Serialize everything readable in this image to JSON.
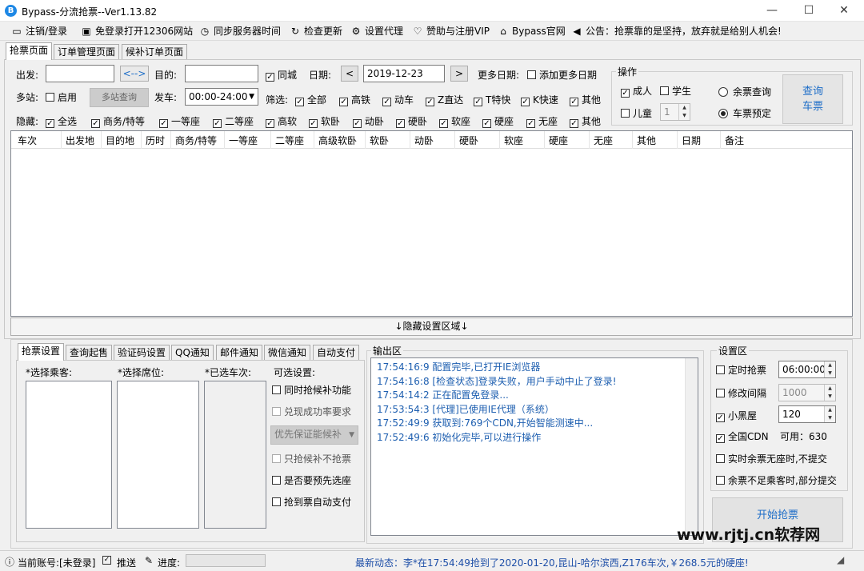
{
  "window": {
    "title": "Bypass-分流抢票--Ver1.13.82",
    "app_icon": "bypass-logo",
    "minimize": "—",
    "maximize": "☐",
    "close": "✕"
  },
  "menu": [
    {
      "label": "注销/登录",
      "icon": "monitor-icon"
    },
    {
      "label": "免登录打开12306网站",
      "icon": "window-icon"
    },
    {
      "label": "同步服务器时间",
      "icon": "clock-icon"
    },
    {
      "label": "检查更新",
      "icon": "refresh-icon"
    },
    {
      "label": "设置代理",
      "icon": "gear-icon"
    },
    {
      "label": "赞助与注册VIP",
      "icon": "heart-icon"
    },
    {
      "label": "Bypass官网",
      "icon": "home-icon"
    },
    {
      "label": "公告：抢票靠的是坚持，放弃就是给别人机会!",
      "icon": "speaker-icon"
    }
  ],
  "main_tabs": [
    "抢票页面",
    "订单管理页面",
    "候补订单页面"
  ],
  "query": {
    "from_label": "出发:",
    "from_value": "",
    "swap_label": "<-->",
    "to_label": "目的:",
    "to_value": "",
    "same_city_label": "同城",
    "same_city_checked": true,
    "date_label": "日期:",
    "date_prev": "<",
    "date_value": "2019-12-23",
    "date_next": ">",
    "more_dates_label": "更多日期:",
    "add_more_dates_label": "添加更多日期",
    "multi_station_label": "多站:",
    "enable_label": "启用",
    "multi_query_button": "多站查询",
    "depart_label": "发车:",
    "depart_value": "00:00-24:00",
    "filter_label": "筛选:",
    "filters": [
      "全部",
      "高铁",
      "动车",
      "Z直达",
      "T特快",
      "K快速",
      "其他"
    ],
    "hide_label": "隐藏:",
    "hide_options": [
      "全选",
      "商务/特等",
      "一等座",
      "二等座",
      "高软",
      "软卧",
      "动卧",
      "硬卧",
      "软座",
      "硬座",
      "无座",
      "其他"
    ]
  },
  "operation": {
    "title": "操作",
    "adult_label": "成人",
    "student_label": "学生",
    "child_label": "儿童",
    "child_count": "1",
    "remaining_query_label": "余票查询",
    "reserve_label": "车票预定",
    "query_button": "查询\n车票"
  },
  "table": {
    "columns": [
      "车次",
      "出发地",
      "目的地",
      "历时",
      "商务/特等",
      "一等座",
      "二等座",
      "高级软卧",
      "软卧",
      "动卧",
      "硬卧",
      "软座",
      "硬座",
      "无座",
      "其他",
      "日期",
      "备注"
    ]
  },
  "hide_settings_bar": "↓隐藏设置区域↓",
  "settings_tabs": [
    "抢票设置",
    "查询起售",
    "验证码设置",
    "QQ通知",
    "邮件通知",
    "微信通知",
    "自动支付"
  ],
  "ticket_settings": {
    "passengers_label": "*选择乘客:",
    "seats_label": "*选择席位:",
    "selected_trains_label": "*已选车次:",
    "options_label": "可选设置:",
    "options": [
      {
        "label": "同时抢候补功能",
        "checked": false,
        "disabled": false
      },
      {
        "label": "兑现成功率要求",
        "checked": false,
        "disabled": true
      },
      {
        "label": "只抢候补不抢票",
        "checked": false,
        "disabled": true
      },
      {
        "label": "是否要预先选座",
        "checked": false,
        "disabled": false
      },
      {
        "label": "抢到票自动支付",
        "checked": false,
        "disabled": false
      }
    ],
    "priority_select": "优先保证能候补"
  },
  "output": {
    "title": "输出区",
    "logs": [
      "17:54:16:9  配置完毕,已打开IE浏览器",
      "17:54:16:8  [检查状态]登录失败，用户手动中止了登录!",
      "17:54:14:2  正在配置免登录...",
      "17:53:54:3  [代理]已使用IE代理（系统）",
      "17:52:49:9  获取到:769个CDN,开始智能测速中...",
      "17:52:49:6  初始化完毕,可以进行操作"
    ]
  },
  "settings_area": {
    "title": "设置区",
    "timed_label": "定时抢票",
    "timed_value": "06:00:00",
    "interval_label": "修改间隔",
    "interval_value": "1000",
    "blackroom_label": "小黑屋",
    "blackroom_value": "120",
    "cdn_label": "全国CDN",
    "cdn_available": "可用：630",
    "no_seat_label": "实时余票无座时,不提交",
    "partial_label": "余票不足乘客时,部分提交",
    "start_button": "开始抢票"
  },
  "status": {
    "account_label": "当前账号:[未登录]",
    "push_label": "推送",
    "progress_label": "进度:",
    "progress": 0,
    "news": "最新动态：李*在17:54:49抢到了2020-01-20,昆山-哈尔滨西,Z176车次,￥268.5元的硬座!",
    "watermark": "www.rjtj.cn软荐网"
  },
  "colors": {
    "accent": "#1e6ec8",
    "log_text": "#1e5fb0",
    "news": "#1e4fa8"
  }
}
